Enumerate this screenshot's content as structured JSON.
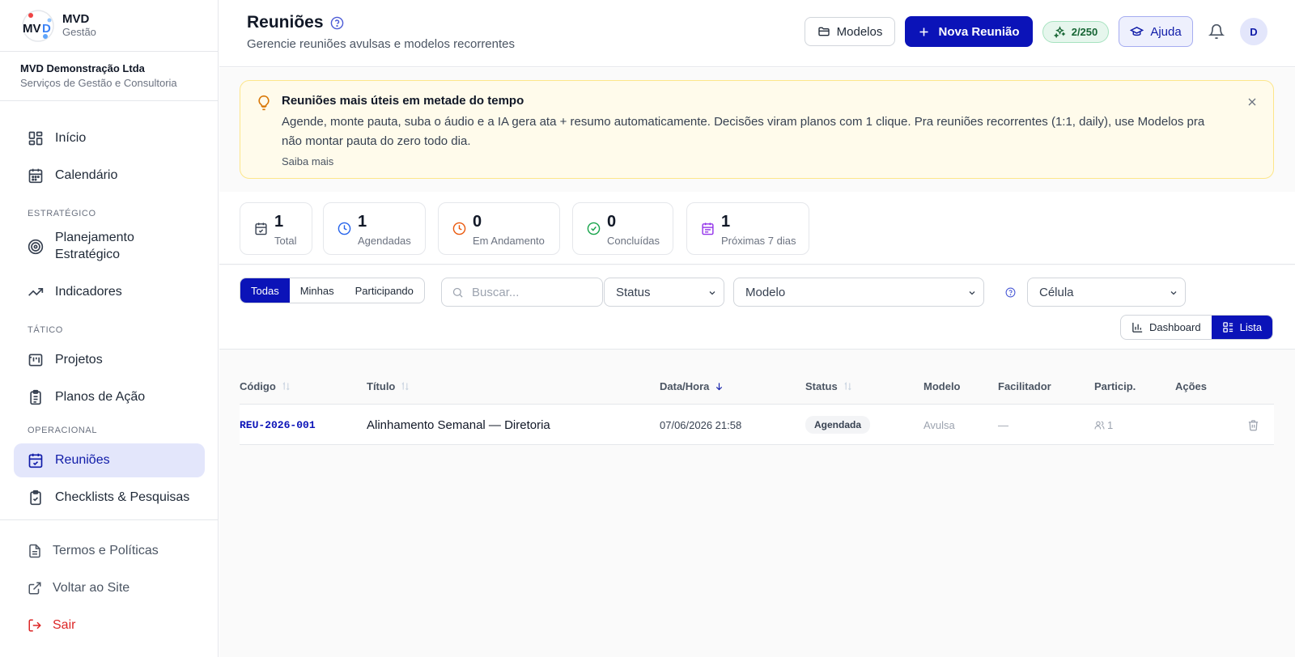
{
  "brand": {
    "name": "MVD",
    "sub": "Gestão"
  },
  "company": {
    "name": "MVD Demonstração Ltda",
    "sub": "Serviços de Gestão e Consultoria"
  },
  "nav": {
    "inicio": "Início",
    "calendario": "Calendário",
    "section_estrategico": "ESTRATÉGICO",
    "planejamento": "Planejamento Estratégico",
    "indicadores": "Indicadores",
    "section_tatico": "TÁTICO",
    "projetos": "Projetos",
    "planos": "Planos de Ação",
    "section_operacional": "OPERACIONAL",
    "reunioes": "Reuniões",
    "checklists": "Checklists & Pesquisas"
  },
  "footer_nav": {
    "termos": "Termos e Políticas",
    "voltar": "Voltar ao Site",
    "sair": "Sair"
  },
  "header": {
    "title": "Reuniões",
    "subtitle": "Gerencie reuniões avulsas e modelos recorrentes",
    "models_label": "Modelos",
    "new_label": "Nova Reunião",
    "credits": "2/250",
    "help_label": "Ajuda",
    "avatar_initial": "D"
  },
  "banner": {
    "title": "Reuniões mais úteis em metade do tempo",
    "text": "Agende, monte pauta, suba o áudio e a IA gera ata + resumo automaticamente. Decisões viram planos com 1 clique. Pra reuniões recorrentes (1:1, daily), use Modelos pra não montar pauta do zero todo dia.",
    "link": "Saiba mais"
  },
  "stats": [
    {
      "value": "1",
      "label": "Total",
      "color": "#374151"
    },
    {
      "value": "1",
      "label": "Agendadas",
      "color": "#2563eb"
    },
    {
      "value": "0",
      "label": "Em Andamento",
      "color": "#ea580c"
    },
    {
      "value": "0",
      "label": "Concluídas",
      "color": "#16a34a"
    },
    {
      "value": "1",
      "label": "Próximas 7 dias",
      "color": "#9333ea"
    }
  ],
  "filters": {
    "tabs": [
      "Todas",
      "Minhas",
      "Participando"
    ],
    "search_placeholder": "Buscar...",
    "status": "Status",
    "modelo": "Modelo",
    "celula": "Célula"
  },
  "view": {
    "dashboard": "Dashboard",
    "lista": "Lista"
  },
  "table": {
    "headers": {
      "codigo": "Código",
      "titulo": "Título",
      "data": "Data/Hora",
      "status": "Status",
      "modelo": "Modelo",
      "facilitador": "Facilitador",
      "particip": "Particip.",
      "acoes": "Ações"
    },
    "rows": [
      {
        "codigo": "REU-2026-001",
        "titulo": "Alinhamento Semanal — Diretoria",
        "data": "07/06/2026 21:58",
        "status": "Agendada",
        "modelo": "Avulsa",
        "facilitador": "—",
        "particip": "1"
      }
    ]
  },
  "colors": {
    "primary": "#0b13b8",
    "active_bg": "#e3e6fb",
    "danger": "#dc2626",
    "banner_bg": "#fffbeb"
  }
}
